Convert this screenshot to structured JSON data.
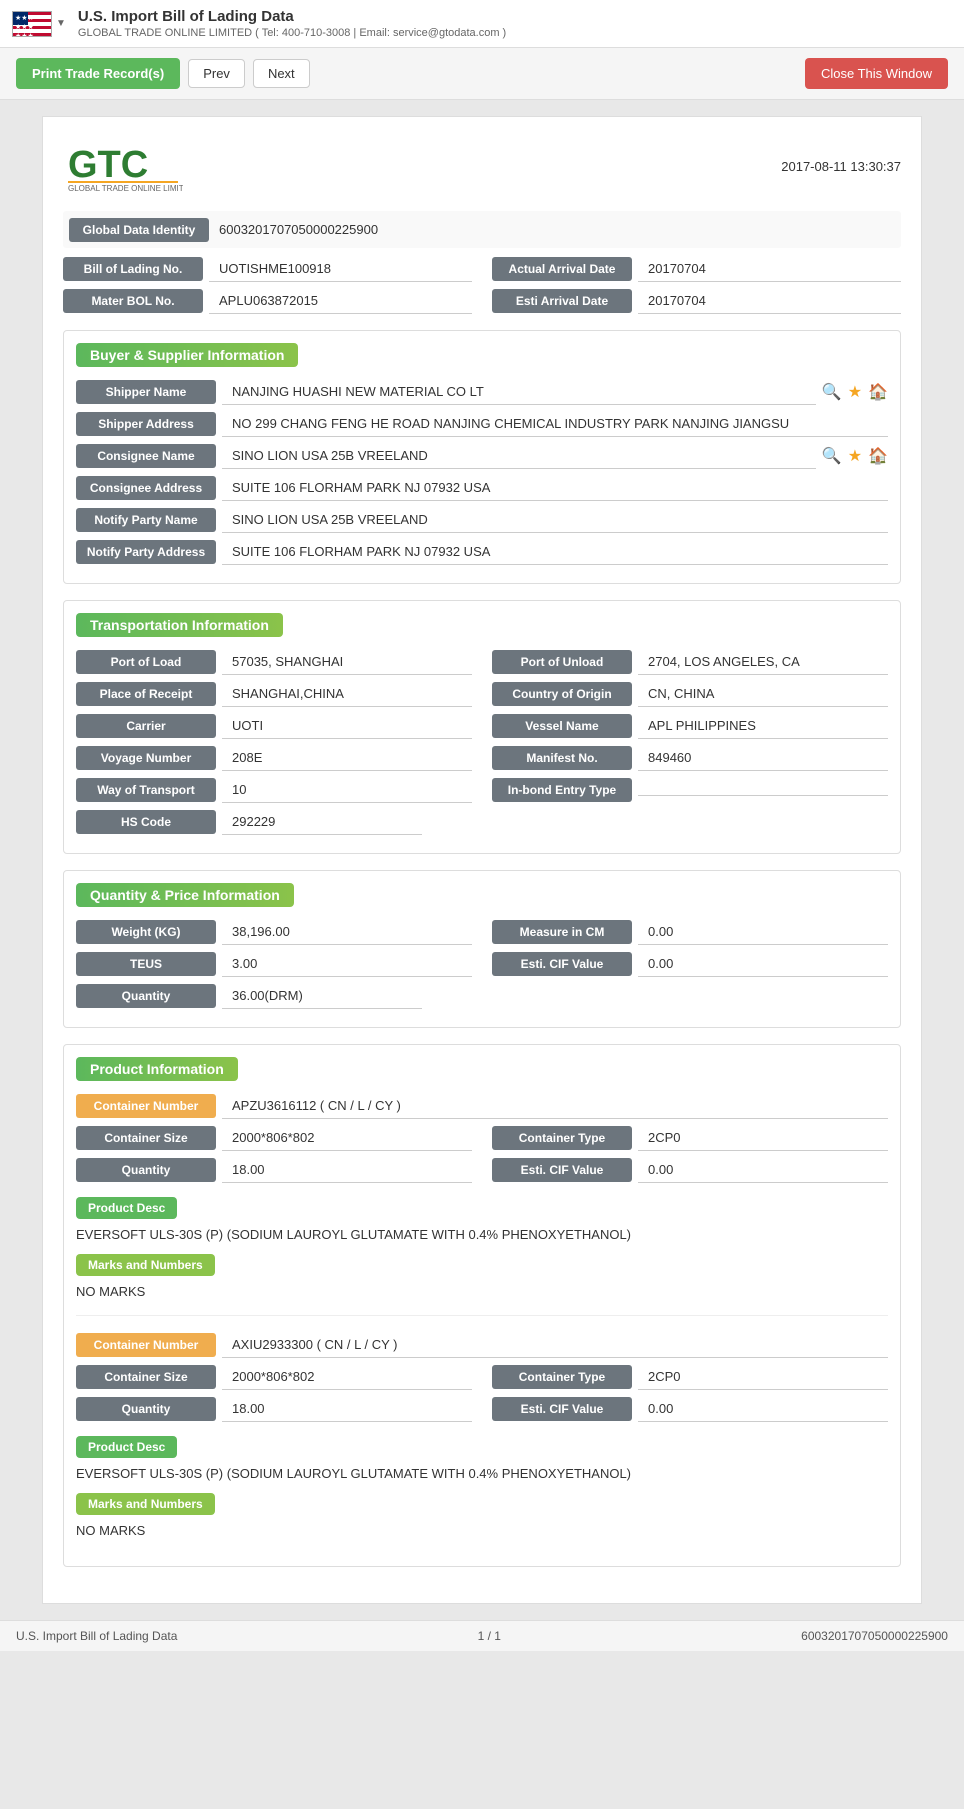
{
  "topbar": {
    "title": "U.S. Import Bill of Lading Data",
    "subtitle": "GLOBAL TRADE ONLINE LIMITED ( Tel: 400-710-3008 | Email: service@gtodata.com )",
    "dropdown_arrow": "▼"
  },
  "toolbar": {
    "print_label": "Print Trade Record(s)",
    "prev_label": "Prev",
    "next_label": "Next",
    "close_label": "Close This Window"
  },
  "page": {
    "timestamp": "2017-08-11 13:30:37",
    "logo_alt": "GLOBAL TRADE ONLINE LIMITED",
    "global_data_identity_label": "Global Data Identity",
    "global_data_identity_value": "6003201707050000225900",
    "bill_of_lading_label": "Bill of Lading No.",
    "bill_of_lading_value": "UOTISHME100918",
    "actual_arrival_date_label": "Actual Arrival Date",
    "actual_arrival_date_value": "20170704",
    "mater_bol_label": "Mater BOL No.",
    "mater_bol_value": "APLU063872015",
    "esti_arrival_label": "Esti Arrival Date",
    "esti_arrival_value": "20170704",
    "buyer_supplier_title": "Buyer & Supplier Information",
    "shipper_name_label": "Shipper Name",
    "shipper_name_value": "NANJING HUASHI NEW MATERIAL CO LT",
    "shipper_address_label": "Shipper Address",
    "shipper_address_value": "NO 299 CHANG FENG HE ROAD NANJING CHEMICAL INDUSTRY PARK NANJING JIANGSU",
    "consignee_name_label": "Consignee Name",
    "consignee_name_value": "SINO LION USA 25B VREELAND",
    "consignee_address_label": "Consignee Address",
    "consignee_address_value": "SUITE 106 FLORHAM PARK NJ 07932 USA",
    "notify_party_name_label": "Notify Party Name",
    "notify_party_name_value": "SINO LION USA 25B VREELAND",
    "notify_party_address_label": "Notify Party Address",
    "notify_party_address_value": "SUITE 106 FLORHAM PARK NJ 07932 USA",
    "transportation_title": "Transportation Information",
    "port_of_load_label": "Port of Load",
    "port_of_load_value": "57035, SHANGHAI",
    "port_of_unload_label": "Port of Unload",
    "port_of_unload_value": "2704, LOS ANGELES, CA",
    "place_of_receipt_label": "Place of Receipt",
    "place_of_receipt_value": "SHANGHAI,CHINA",
    "country_of_origin_label": "Country of Origin",
    "country_of_origin_value": "CN, CHINA",
    "carrier_label": "Carrier",
    "carrier_value": "UOTI",
    "vessel_name_label": "Vessel Name",
    "vessel_name_value": "APL PHILIPPINES",
    "voyage_number_label": "Voyage Number",
    "voyage_number_value": "208E",
    "manifest_no_label": "Manifest No.",
    "manifest_no_value": "849460",
    "way_of_transport_label": "Way of Transport",
    "way_of_transport_value": "10",
    "inbond_entry_label": "In-bond Entry Type",
    "inbond_entry_value": "",
    "hs_code_label": "HS Code",
    "hs_code_value": "292229",
    "qty_price_title": "Quantity & Price Information",
    "weight_kg_label": "Weight (KG)",
    "weight_kg_value": "38,196.00",
    "measure_cm_label": "Measure in CM",
    "measure_cm_value": "0.00",
    "teus_label": "TEUS",
    "teus_value": "3.00",
    "esti_cif_label1": "Esti. CIF Value",
    "esti_cif_value1": "0.00",
    "quantity_label1": "Quantity",
    "quantity_value1": "36.00(DRM)",
    "product_info_title": "Product Information",
    "containers": [
      {
        "container_number_label": "Container Number",
        "container_number_value": "APZU3616112 ( CN / L / CY )",
        "container_size_label": "Container Size",
        "container_size_value": "2000*806*802",
        "container_type_label": "Container Type",
        "container_type_value": "2CP0",
        "quantity_label": "Quantity",
        "quantity_value": "18.00",
        "esti_cif_label": "Esti. CIF Value",
        "esti_cif_value": "0.00",
        "product_desc_label": "Product Desc",
        "product_desc_value": "EVERSOFT ULS-30S (P) (SODIUM LAUROYL GLUTAMATE WITH 0.4% PHENOXYETHANOL)",
        "marks_label": "Marks and Numbers",
        "marks_value": "NO MARKS"
      },
      {
        "container_number_label": "Container Number",
        "container_number_value": "AXIU2933300 ( CN / L / CY )",
        "container_size_label": "Container Size",
        "container_size_value": "2000*806*802",
        "container_type_label": "Container Type",
        "container_type_value": "2CP0",
        "quantity_label": "Quantity",
        "quantity_value": "18.00",
        "esti_cif_label": "Esti. CIF Value",
        "esti_cif_value": "0.00",
        "product_desc_label": "Product Desc",
        "product_desc_value": "EVERSOFT ULS-30S (P) (SODIUM LAUROYL GLUTAMATE WITH 0.4% PHENOXYETHANOL)",
        "marks_label": "Marks and Numbers",
        "marks_value": "NO MARKS"
      }
    ],
    "footer_left": "U.S. Import Bill of Lading Data",
    "footer_center": "1 / 1",
    "footer_right": "6003201707050000225900"
  }
}
